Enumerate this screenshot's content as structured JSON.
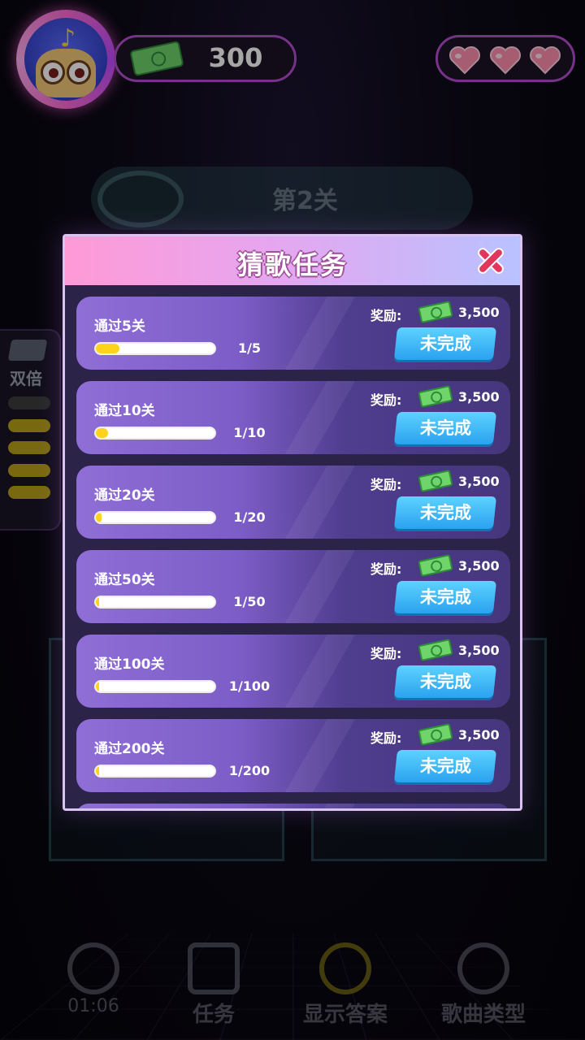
{
  "header": {
    "cash": "300",
    "lives": 3
  },
  "background": {
    "level_label": "第2关",
    "side_label": "双倍",
    "side_pills_on": 4,
    "nav": [
      {
        "label": "01:06",
        "icon": "clock-icon"
      },
      {
        "label": "任务",
        "icon": "task-icon"
      },
      {
        "label": "显示答案",
        "icon": "bulb-icon"
      },
      {
        "label": "歌曲类型",
        "icon": "headphones-icon"
      }
    ]
  },
  "modal": {
    "title": "猜歌任务",
    "reward_label": "奖励:",
    "tasks": [
      {
        "name": "通过5关",
        "current": 1,
        "total": 5,
        "progress_text": "1/5",
        "reward": "3,500",
        "status": "未完成"
      },
      {
        "name": "通过10关",
        "current": 1,
        "total": 10,
        "progress_text": "1/10",
        "reward": "3,500",
        "status": "未完成"
      },
      {
        "name": "通过20关",
        "current": 1,
        "total": 20,
        "progress_text": "1/20",
        "reward": "3,500",
        "status": "未完成"
      },
      {
        "name": "通过50关",
        "current": 1,
        "total": 50,
        "progress_text": "1/50",
        "reward": "3,500",
        "status": "未完成"
      },
      {
        "name": "通过100关",
        "current": 1,
        "total": 100,
        "progress_text": "1/100",
        "reward": "3,500",
        "status": "未完成"
      },
      {
        "name": "通过200关",
        "current": 1,
        "total": 200,
        "progress_text": "1/200",
        "reward": "3,500",
        "status": "未完成"
      }
    ]
  },
  "colors": {
    "accent_pink": "#ff9ad6",
    "progress_yellow": "#ffd21c",
    "button_blue": "#2aa2ef",
    "heart_pink": "#ff8fb0"
  }
}
